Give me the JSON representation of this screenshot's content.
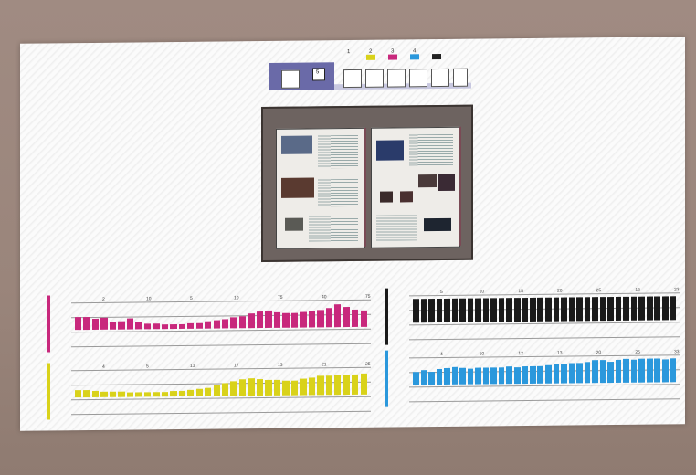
{
  "colors": {
    "magenta": "#c8287c",
    "yellow": "#d9d21a",
    "cyan": "#2b98dc",
    "black": "#1a1a1a",
    "toolbar": "#6a6aa8"
  },
  "toolbar": {
    "tab_number_1": "1",
    "tab_number_2": "2",
    "tab_number_3": "3",
    "tab_number_4": "4",
    "current_tab": "5"
  },
  "preview": {
    "icon": "document-spread-thumbnail"
  },
  "chart_data": [
    {
      "type": "bar",
      "series": [
        {
          "color": "magenta",
          "values": [
            0.55,
            0.55,
            0.45,
            0.5,
            0.3,
            0.35,
            0.45,
            0.3,
            0.25,
            0.25,
            0.2,
            0.2,
            0.2,
            0.25,
            0.25,
            0.3,
            0.35,
            0.4,
            0.45,
            0.5,
            0.6,
            0.7,
            0.75,
            0.65,
            0.6,
            0.6,
            0.65,
            0.7,
            0.75,
            0.8,
            0.95,
            0.85,
            0.75,
            0.7
          ]
        }
      ],
      "tick_labels": [
        "2",
        "10",
        "5",
        "10",
        "75",
        "40",
        "75"
      ]
    },
    {
      "type": "bar",
      "series": [
        {
          "color": "black",
          "values": [
            1,
            1,
            1,
            1,
            1,
            1,
            1,
            1,
            1,
            1,
            1,
            1,
            1,
            1,
            1,
            1,
            1,
            1,
            1,
            1,
            1,
            1,
            1,
            1,
            1,
            1,
            1,
            1,
            1,
            1,
            1,
            1,
            1,
            1
          ]
        }
      ],
      "tick_labels": [
        "5",
        "10",
        "15",
        "20",
        "25",
        "13",
        "23"
      ]
    },
    {
      "type": "bar",
      "series": [
        {
          "color": "yellow",
          "values": [
            0.3,
            0.3,
            0.28,
            0.25,
            0.25,
            0.22,
            0.2,
            0.2,
            0.18,
            0.2,
            0.2,
            0.22,
            0.25,
            0.28,
            0.3,
            0.35,
            0.45,
            0.55,
            0.6,
            0.7,
            0.75,
            0.7,
            0.65,
            0.65,
            0.6,
            0.6,
            0.7,
            0.75,
            0.8,
            0.8,
            0.85,
            0.85,
            0.85,
            0.9
          ]
        }
      ],
      "tick_labels": [
        "4",
        "5",
        "13",
        "17",
        "13",
        "21",
        "25"
      ]
    },
    {
      "type": "bar",
      "series": [
        {
          "color": "cyan",
          "values": [
            0.55,
            0.6,
            0.55,
            0.65,
            0.7,
            0.75,
            0.7,
            0.65,
            0.7,
            0.7,
            0.7,
            0.7,
            0.72,
            0.7,
            0.72,
            0.75,
            0.75,
            0.78,
            0.8,
            0.8,
            0.85,
            0.85,
            0.9,
            0.95,
            0.95,
            0.9,
            0.95,
            1,
            0.95,
            1,
            1,
            1,
            0.95,
            1
          ]
        }
      ],
      "tick_labels": [
        "4",
        "10",
        "12",
        "13",
        "20",
        "25",
        "33"
      ]
    }
  ]
}
